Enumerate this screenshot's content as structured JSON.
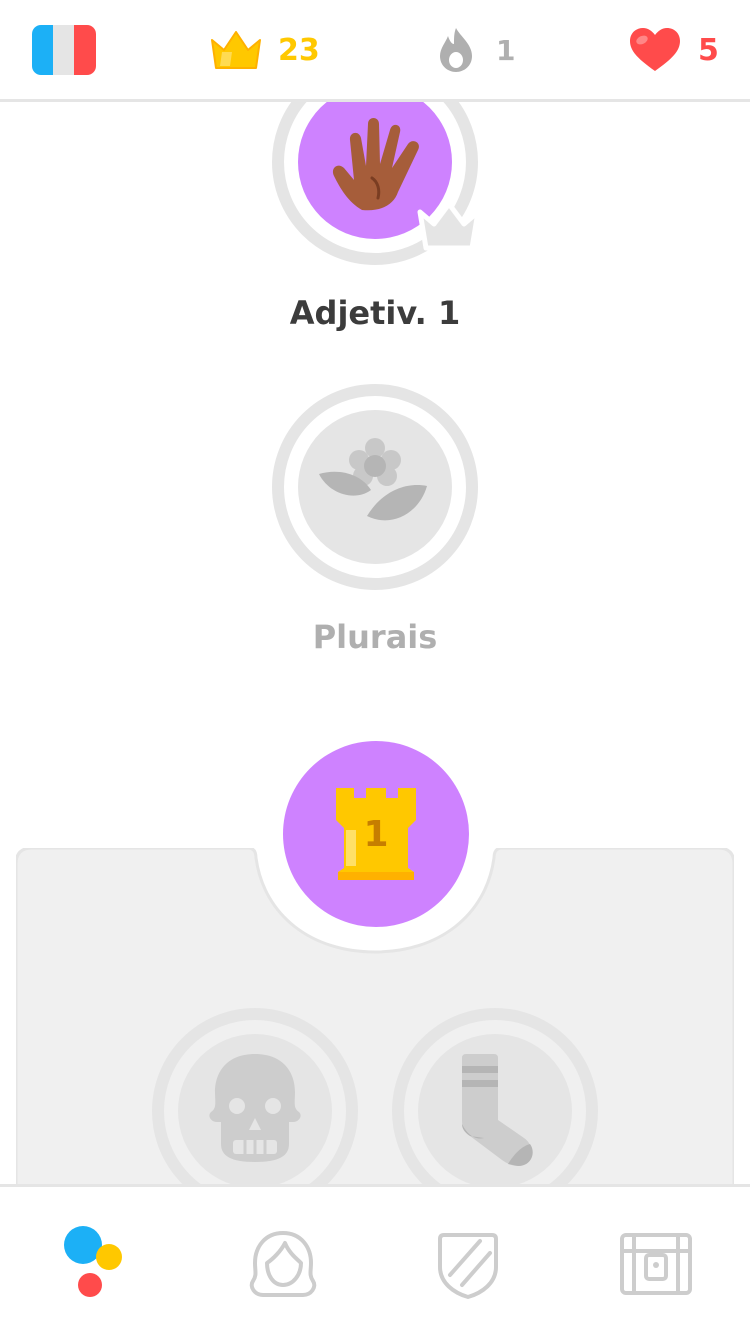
{
  "topbar": {
    "course_flag": "france-flag-icon",
    "crowns": "23",
    "streak": "1",
    "hearts": "5"
  },
  "skills": [
    {
      "name": "Adjetiv. 1",
      "icon": "waving-hand-icon",
      "state": "unlocked",
      "badge": "crown-icon"
    },
    {
      "name": "Plurais",
      "icon": "flower-icon",
      "state": "locked"
    },
    {
      "name": "",
      "icon": "skull-icon",
      "state": "locked"
    },
    {
      "name": "",
      "icon": "sock-icon",
      "state": "locked"
    }
  ],
  "checkpoint": {
    "number": "1",
    "icon": "castle-icon"
  },
  "bottom_nav": [
    {
      "id": "learn",
      "icon": "learn-dots-icon",
      "active": true
    },
    {
      "id": "profile",
      "icon": "profile-icon",
      "active": false
    },
    {
      "id": "leaderboard",
      "icon": "shield-icon",
      "active": false
    },
    {
      "id": "shop",
      "icon": "treasure-chest-icon",
      "active": false
    }
  ],
  "colors": {
    "accent_purple": "#ce82ff",
    "gold": "#ffc800",
    "heart_red": "#ff4b4b",
    "locked_gray": "#e5e5e5",
    "text_dark": "#3c3c3c",
    "text_gray": "#afafaf"
  }
}
